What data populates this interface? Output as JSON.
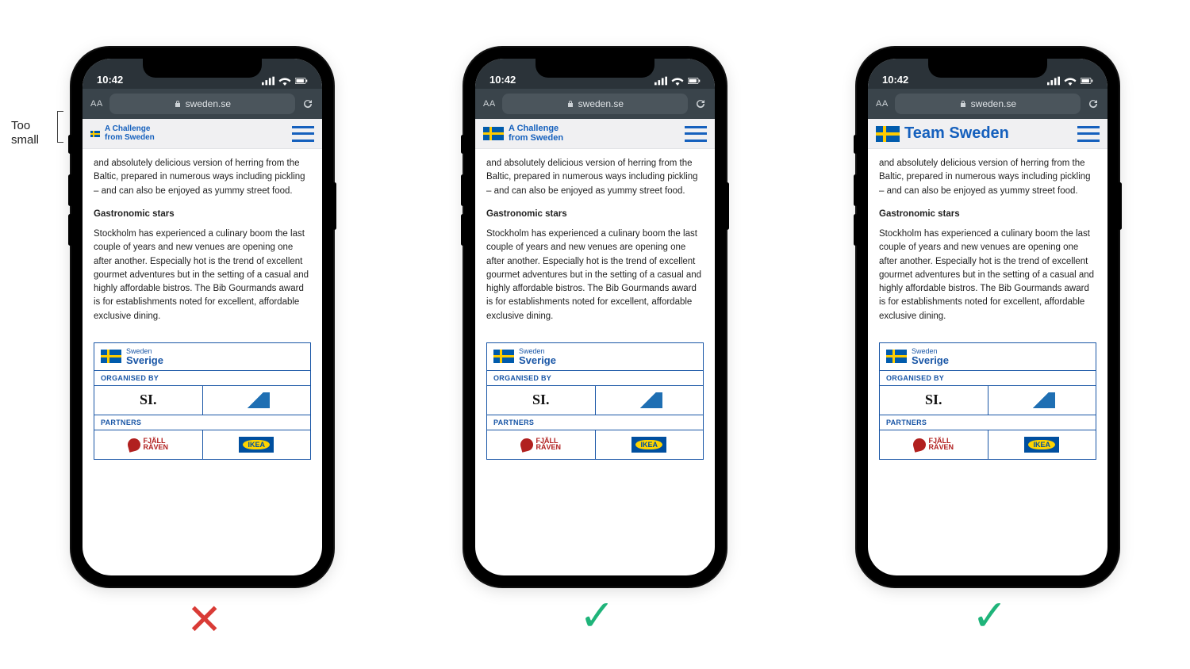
{
  "annotation": {
    "label": "Too\nsmall"
  },
  "statusbar": {
    "time": "10:42"
  },
  "urlbar": {
    "aa": "AA",
    "host": "sweden.se"
  },
  "logo": {
    "two_line_1": "A Challenge",
    "two_line_2": "from Sweden",
    "single": "Team Sweden"
  },
  "content": {
    "para1": "and absolutely delicious version of herring from the Baltic, prepared in numerous ways including pickling – and can also be enjoyed as yummy street food.",
    "subhead": "Gastronomic stars",
    "para2": "Stockholm has experienced a culinary boom the last couple of years and new venues are opening one after another. Especially hot is the trend of excellent gourmet adventures but in the setting of a casual and highly affordable bistros. The Bib Gourmands award is for establishments noted for excellent, affordable exclusive dining."
  },
  "footer": {
    "head_line1": "Sweden",
    "head_line2": "Sverige",
    "organised_label": "ORGANISED BY",
    "partners_label": "PARTNERS",
    "si": "SI.",
    "fjall_line1": "FJÄLL",
    "fjall_line2": "RÄVEN",
    "ikea": "IKEA"
  },
  "verdict": {
    "x": "✕",
    "check": "✓"
  }
}
